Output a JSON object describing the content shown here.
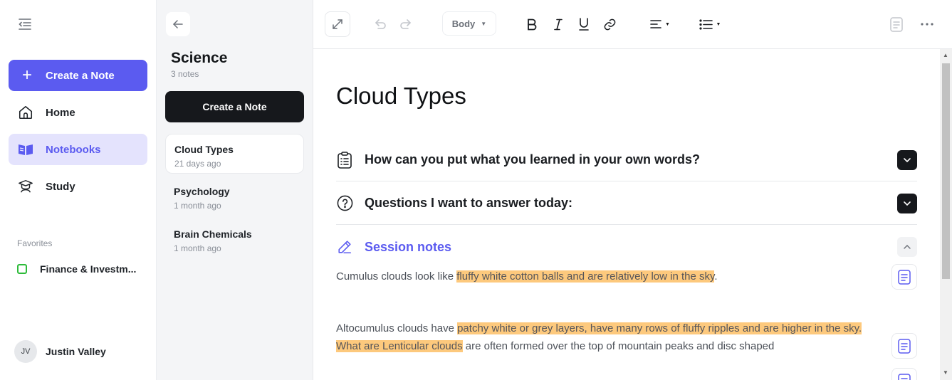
{
  "sidebar": {
    "create_label": "Create a Note",
    "nav": [
      {
        "label": "Home"
      },
      {
        "label": "Notebooks"
      },
      {
        "label": "Study"
      }
    ],
    "favorites_title": "Favorites",
    "favorites": [
      {
        "label": "Finance & Investm..."
      }
    ],
    "user": {
      "initials": "JV",
      "name": "Justin Valley"
    }
  },
  "notebook": {
    "title": "Science",
    "count": "3 notes",
    "create_label": "Create a Note",
    "notes": [
      {
        "title": "Cloud Types",
        "date": "21 days ago"
      },
      {
        "title": "Psychology",
        "date": "1 month ago"
      },
      {
        "title": "Brain Chemicals",
        "date": "1 month ago"
      }
    ]
  },
  "toolbar": {
    "format_value": "Body"
  },
  "document": {
    "title": "Cloud Types",
    "sections": [
      {
        "label": "How can you put what you learned in your own words?"
      },
      {
        "label": "Questions I want to answer today:"
      },
      {
        "label": "Session notes"
      }
    ],
    "paragraphs": {
      "p1_plain": "Cumulus clouds look like ",
      "p1_hl": "fluffy white cotton balls and are relatively low in the sky",
      "p1_end": ".",
      "p2_plain": "Altocumulus clouds have ",
      "p2_hl": "patchy white or grey layers, have many rows of fluffy ripples and are higher in the sky.",
      "p3_hl": "What are Lenticular clouds",
      "p3_plain": " are often formed over the top of mountain peaks and disc shaped"
    }
  },
  "colors": {
    "accent": "#5b5bf0",
    "highlight": "#fdc97d",
    "favorite": "#2dbb3a"
  }
}
